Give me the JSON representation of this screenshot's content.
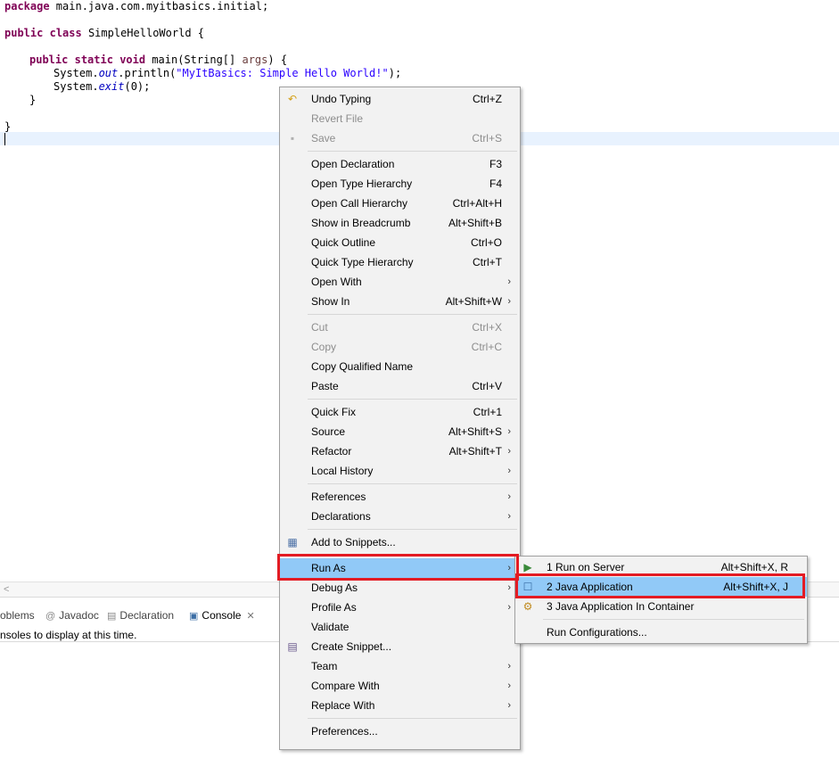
{
  "editor": {
    "line1": {
      "kw": "package",
      "rest": " main.java.com.myitbasics.initial;"
    },
    "line2": {
      "kw1": "public",
      "kw2": "class",
      "rest": " SimpleHelloWorld {"
    },
    "line3": {
      "kw1": "public",
      "kw2": "static",
      "kw3": "void",
      "mid": " main(String[] ",
      "param": "args",
      "end": ") {"
    },
    "line4": {
      "pre": "System.",
      "field": "out",
      "mid": ".println(",
      "str": "\"MyItBasics: Simple Hello World!\"",
      "end": ");"
    },
    "line5": {
      "pre": "System.",
      "method": "exit",
      "end": "(0);"
    },
    "line6": "}",
    "line7": "}"
  },
  "bottom_tabs": {
    "problems": "oblems",
    "javadoc": "Javadoc",
    "declaration": "Declaration",
    "console": "Console",
    "console_message": "nsoles to display at this time."
  },
  "context_menu": {
    "undo_typing": {
      "label": "Undo Typing",
      "shortcut": "Ctrl+Z",
      "icon": "undo-icon"
    },
    "revert_file": {
      "label": "Revert File"
    },
    "save": {
      "label": "Save",
      "shortcut": "Ctrl+S",
      "icon": "save-icon"
    },
    "open_declaration": {
      "label": "Open Declaration",
      "shortcut": "F3"
    },
    "open_type_hierarchy": {
      "label": "Open Type Hierarchy",
      "shortcut": "F4"
    },
    "open_call_hierarchy": {
      "label": "Open Call Hierarchy",
      "shortcut": "Ctrl+Alt+H"
    },
    "show_in_breadcrumb": {
      "label": "Show in Breadcrumb",
      "shortcut": "Alt+Shift+B"
    },
    "quick_outline": {
      "label": "Quick Outline",
      "shortcut": "Ctrl+O"
    },
    "quick_type_hierarchy": {
      "label": "Quick Type Hierarchy",
      "shortcut": "Ctrl+T"
    },
    "open_with": {
      "label": "Open With"
    },
    "show_in": {
      "label": "Show In",
      "shortcut": "Alt+Shift+W"
    },
    "cut": {
      "label": "Cut",
      "shortcut": "Ctrl+X"
    },
    "copy": {
      "label": "Copy",
      "shortcut": "Ctrl+C"
    },
    "copy_qualified_name": {
      "label": "Copy Qualified Name"
    },
    "paste": {
      "label": "Paste",
      "shortcut": "Ctrl+V"
    },
    "quick_fix": {
      "label": "Quick Fix",
      "shortcut": "Ctrl+1"
    },
    "source": {
      "label": "Source",
      "shortcut": "Alt+Shift+S"
    },
    "refactor": {
      "label": "Refactor",
      "shortcut": "Alt+Shift+T"
    },
    "local_history": {
      "label": "Local History"
    },
    "references": {
      "label": "References"
    },
    "declarations": {
      "label": "Declarations"
    },
    "add_to_snippets": {
      "label": "Add to Snippets...",
      "icon": "snippets-icon"
    },
    "run_as": {
      "label": "Run As"
    },
    "debug_as": {
      "label": "Debug As"
    },
    "profile_as": {
      "label": "Profile As"
    },
    "validate": {
      "label": "Validate"
    },
    "create_snippet": {
      "label": "Create Snippet...",
      "icon": "create-snippet-icon"
    },
    "team": {
      "label": "Team"
    },
    "compare_with": {
      "label": "Compare With"
    },
    "replace_with": {
      "label": "Replace With"
    },
    "preferences": {
      "label": "Preferences..."
    }
  },
  "run_as_submenu": {
    "run_on_server": {
      "label": "1 Run on Server",
      "shortcut": "Alt+Shift+X, R",
      "icon": "server-run-icon"
    },
    "java_application": {
      "label": "2 Java Application",
      "shortcut": "Alt+Shift+X, J",
      "icon": "java-app-icon"
    },
    "java_application_container": {
      "label": "3 Java Application In Container",
      "icon": "container-icon"
    },
    "run_configurations": {
      "label": "Run Configurations..."
    }
  },
  "colors": {
    "highlight_red": "#e31b23",
    "menu_hover": "#91c9f7",
    "keyword": "#7f0055",
    "string": "#2a00ff"
  },
  "arrow_glyph": "›"
}
